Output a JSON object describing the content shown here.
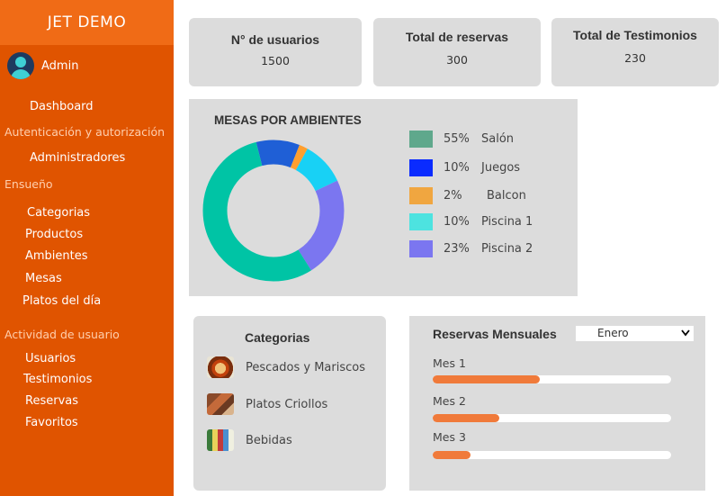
{
  "brand": "JET DEMO",
  "user": {
    "name": "Admin"
  },
  "sidebar": {
    "dashboard": "Dashboard",
    "section_auth": "Autenticación y autorización",
    "administradores": "Administradores",
    "section_ensueno": "Ensueño",
    "categorias": "Categorias",
    "productos": "Productos",
    "ambientes": "Ambientes",
    "mesas": "Mesas",
    "platos": "Platos del día",
    "section_actividad": "Actividad de usuario",
    "usuarios": "Usuarios",
    "testimonios": "Testimonios",
    "reservas": "Reservas",
    "favoritos": "Favoritos"
  },
  "stats": [
    {
      "title": "N° de usuarios",
      "value": "1500"
    },
    {
      "title": "Total de reservas",
      "value": "300"
    },
    {
      "title": "Total de Testimonios",
      "value": "230"
    }
  ],
  "mesas": {
    "title": "MESAS POR AMBIENTES",
    "legend": [
      {
        "pct": "55%",
        "name": "Salón",
        "color": "#5fa88c"
      },
      {
        "pct": "10%",
        "name": "Juegos",
        "color": "#0a2bff"
      },
      {
        "pct": "2%",
        "name": "Balcon",
        "color": "#f0a640"
      },
      {
        "pct": "10%",
        "name": "Piscina 1",
        "color": "#4de3e0"
      },
      {
        "pct": "23%",
        "name": "Piscina 2",
        "color": "#7b76f0"
      }
    ]
  },
  "chart_data": {
    "type": "pie",
    "title": "MESAS POR AMBIENTES",
    "categories": [
      "Salón",
      "Juegos",
      "Balcon",
      "Piscina 1",
      "Piscina 2"
    ],
    "values": [
      55,
      10,
      2,
      10,
      23
    ],
    "colors": [
      "#00c4a5",
      "#1f5fd6",
      "#ff9f2e",
      "#18d1f5",
      "#7b76f0"
    ],
    "legend_position": "right"
  },
  "categorias": {
    "title": "Categorias",
    "items": [
      {
        "label": "Pescados y Mariscos",
        "icon": "seafood-thumbnail"
      },
      {
        "label": "Platos Criollos",
        "icon": "creole-dish-thumbnail"
      },
      {
        "label": "Bebidas",
        "icon": "drinks-thumbnail"
      }
    ]
  },
  "reservas": {
    "title": "Reservas Mensuales",
    "selected_month": "Enero",
    "rows": [
      {
        "label": "Mes 1",
        "progress": 0.45
      },
      {
        "label": "Mes 2",
        "progress": 0.28
      },
      {
        "label": "Mes 3",
        "progress": 0.16
      }
    ]
  }
}
